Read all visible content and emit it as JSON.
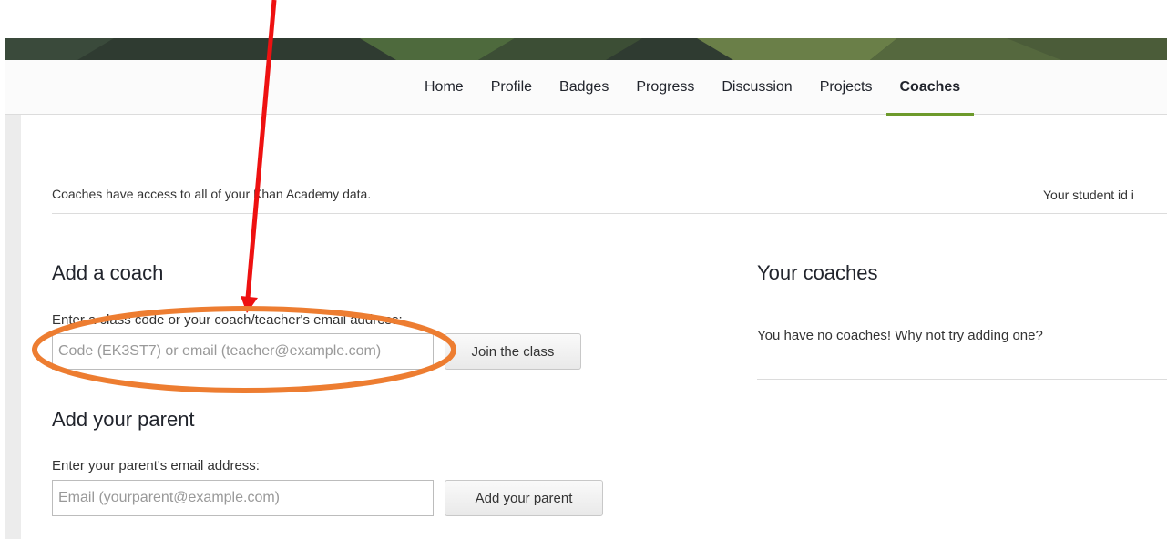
{
  "nav": {
    "tabs": [
      {
        "label": "Home"
      },
      {
        "label": "Profile"
      },
      {
        "label": "Badges"
      },
      {
        "label": "Progress"
      },
      {
        "label": "Discussion"
      },
      {
        "label": "Projects"
      },
      {
        "label": "Coaches",
        "active": true
      }
    ],
    "active_color": "#6d9a2c"
  },
  "info": {
    "access_text": "Coaches have access to all of your Khan Academy data.",
    "student_id_text": "Your student id i"
  },
  "add_coach": {
    "heading": "Add a coach",
    "label": "Enter a class code or your coach/teacher's email address:",
    "placeholder": "Code (EK3ST7) or email (teacher@example.com)",
    "button": "Join the class"
  },
  "add_parent": {
    "heading": "Add your parent",
    "label": "Enter your parent's email address:",
    "placeholder": "Email (yourparent@example.com)",
    "button": "Add your parent"
  },
  "your_coaches": {
    "heading": "Your coaches",
    "empty_text": "You have no coaches! Why not try adding one?"
  },
  "annotation_colors": {
    "arrow": "#ee1111",
    "ellipse": "#ed7d31"
  }
}
